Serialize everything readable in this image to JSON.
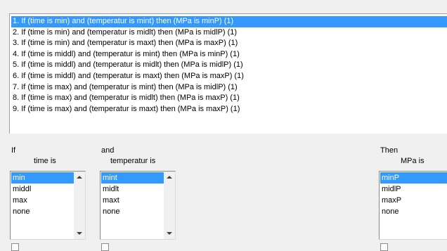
{
  "rules": [
    "1. If (time is min) and (temperatur is mint) then (MPa is minP) (1)",
    "2. If (time is min) and (temperatur is midlt) then (MPa is midlP) (1)",
    "3. If (time is min) and (temperatur is maxt) then (MPa is maxP) (1)",
    "4. If (time is middl) and (temperatur is mint) then (MPa is minP) (1)",
    "5. If (time is middl) and (temperatur is midlt) then (MPa is midlP) (1)",
    "6. If (time is middl) and (temperatur is maxt) then (MPa is maxP) (1)",
    "7. If (time is max) and (temperatur is mint) then (MPa is midlP) (1)",
    "8. If (time is max) and (temperatur is midlt) then (MPa is maxP) (1)",
    "9. If (time is max) and (temperatur is maxt) then (MPa is maxP) (1)"
  ],
  "selected_rule_index": 0,
  "if_block": {
    "header": "If",
    "variable_label": "time is",
    "options": [
      "min",
      "middl",
      "max",
      "none"
    ],
    "selected": "min"
  },
  "and_block": {
    "header": "and",
    "variable_label": "temperatur is",
    "options": [
      "mint",
      "midlt",
      "maxt",
      "none"
    ],
    "selected": "mint"
  },
  "then_block": {
    "header": "Then",
    "variable_label": "MPa is",
    "options": [
      "minP",
      "midlP",
      "maxP",
      "none"
    ],
    "selected": "minP"
  },
  "colors": {
    "selection": "#3399ff",
    "window_bg": "#f0f0f0"
  },
  "icons": [
    "scroll-up-arrow",
    "scroll-down-arrow",
    "checkbox"
  ]
}
